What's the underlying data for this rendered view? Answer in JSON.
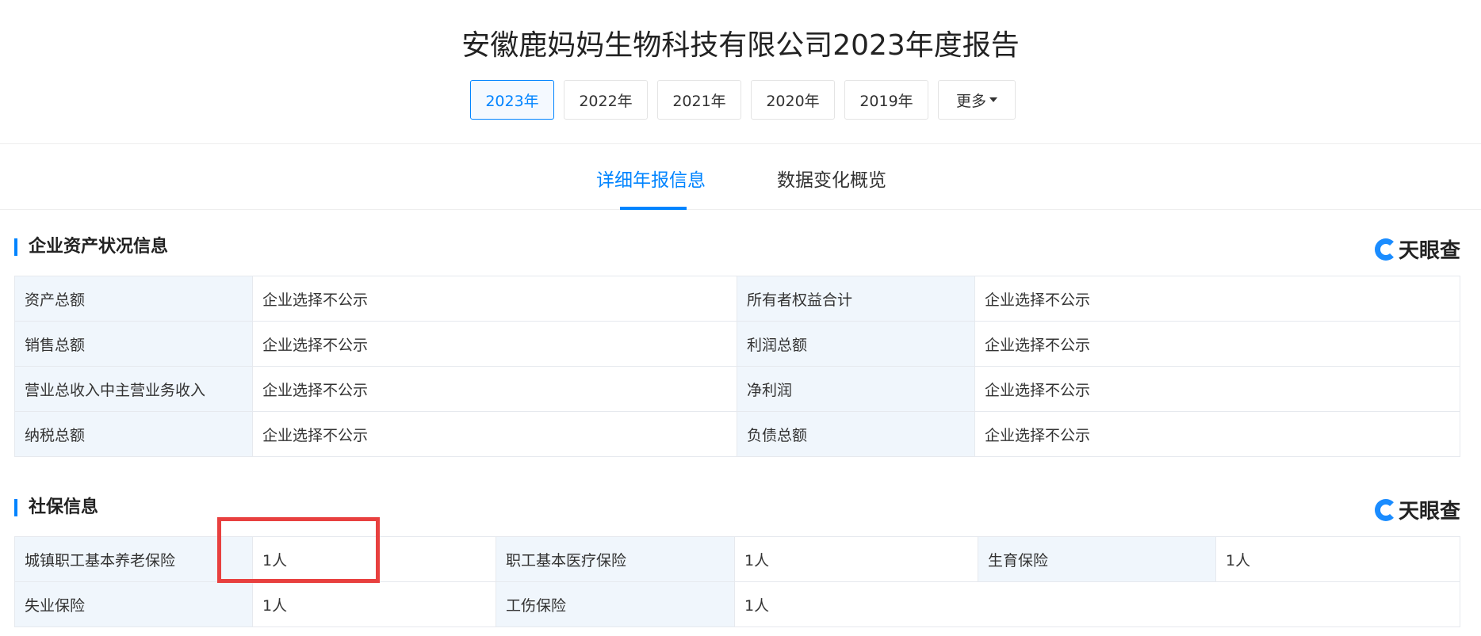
{
  "title": "安徽鹿妈妈生物科技有限公司2023年度报告",
  "years": [
    "2023年",
    "2022年",
    "2021年",
    "2020年",
    "2019年"
  ],
  "more_label": "更多",
  "tabs": [
    "详细年报信息",
    "数据变化概览"
  ],
  "brand": "天眼查",
  "assets": {
    "heading": "企业资产状况信息",
    "rows": [
      [
        "资产总额",
        "企业选择不公示",
        "所有者权益合计",
        "企业选择不公示"
      ],
      [
        "销售总额",
        "企业选择不公示",
        "利润总额",
        "企业选择不公示"
      ],
      [
        "营业总收入中主营业务收入",
        "企业选择不公示",
        "净利润",
        "企业选择不公示"
      ],
      [
        "纳税总额",
        "企业选择不公示",
        "负债总额",
        "企业选择不公示"
      ]
    ]
  },
  "social": {
    "heading": "社保信息",
    "rows": [
      [
        "城镇职工基本养老保险",
        "1人",
        "职工基本医疗保险",
        "1人",
        "生育保险",
        "1人"
      ],
      [
        "失业保险",
        "1人",
        "工伤保险",
        "1人"
      ]
    ]
  },
  "colors": {
    "accent": "#0084ff",
    "highlight": "#e8403f"
  }
}
